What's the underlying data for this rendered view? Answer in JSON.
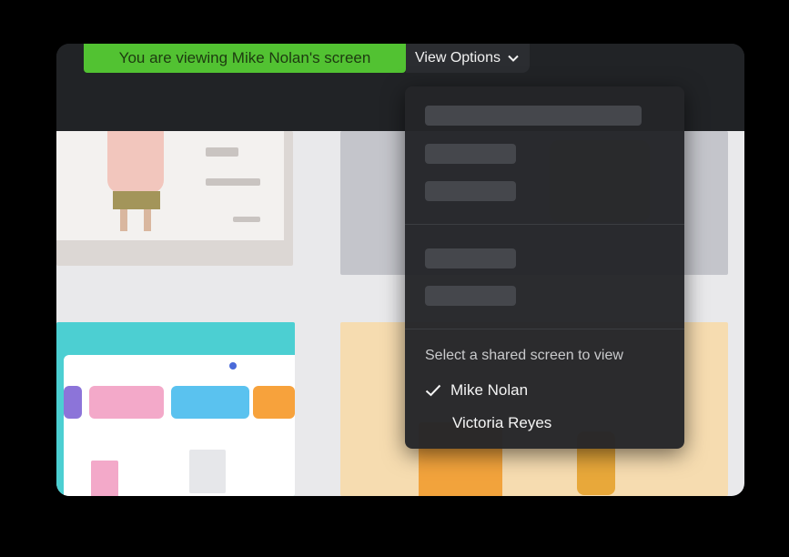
{
  "banner": {
    "text": "You are viewing Mike Nolan's screen"
  },
  "view_options": {
    "label": "View Options",
    "icon": "chevron-down-icon"
  },
  "dropdown": {
    "heading": "Select a shared screen to view",
    "screens": [
      {
        "label": "Mike Nolan",
        "selected": true,
        "icon": "checkmark-icon"
      },
      {
        "label": "Victoria Reyes",
        "selected": false
      }
    ]
  },
  "colors": {
    "banner_green": "#52c232",
    "dropdown_bg": "#242528",
    "placeholder_bar": "#45474c",
    "turquoise": "#4ccfd2",
    "cream": "#f6dcb0"
  }
}
